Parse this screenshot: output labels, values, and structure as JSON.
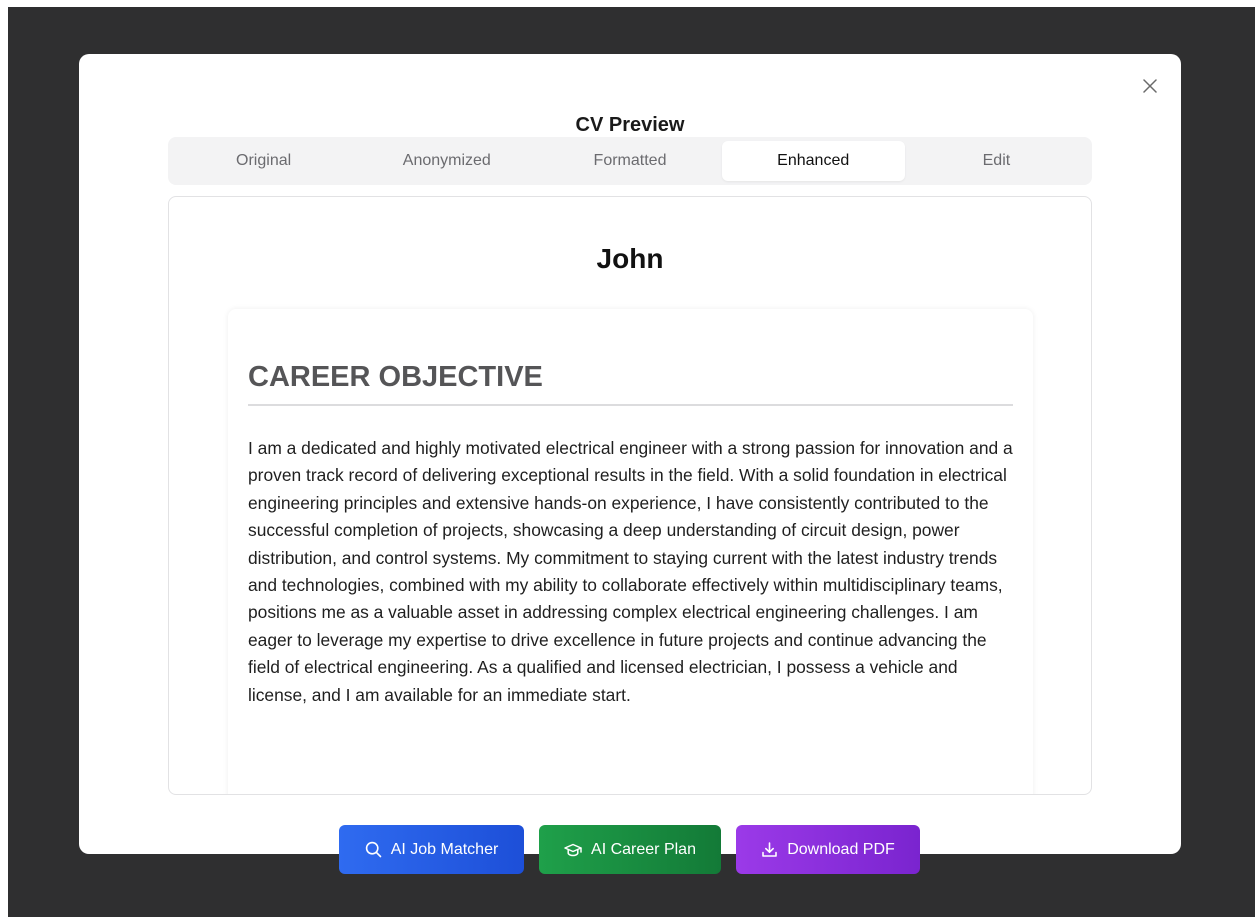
{
  "modal": {
    "title": "CV Preview",
    "close_symbol": "×"
  },
  "tabs": [
    {
      "label": "Original",
      "active": false
    },
    {
      "label": "Anonymized",
      "active": false
    },
    {
      "label": "Formatted",
      "active": false
    },
    {
      "label": "Enhanced",
      "active": true
    },
    {
      "label": "Edit",
      "active": false
    }
  ],
  "cv": {
    "name": "John",
    "section": {
      "heading": "CAREER OBJECTIVE",
      "text": "I am a dedicated and highly motivated electrical engineer with a strong passion for innovation and a proven track record of delivering exceptional results in the field. With a solid foundation in electrical engineering principles and extensive hands-on experience, I have consistently contributed to the successful completion of projects, showcasing a deep understanding of circuit design, power distribution, and control systems. My commitment to staying current with the latest industry trends and technologies, combined with my ability to collaborate effectively within multidisciplinary teams, positions me as a valuable asset in addressing complex electrical engineering challenges. I am eager to leverage my expertise to drive excellence in future projects and continue advancing the field of electrical engineering. As a qualified and licensed electrician, I possess a vehicle and license, and I am available for an immediate start."
    }
  },
  "actions": {
    "job_matcher": {
      "label": "AI Job Matcher",
      "icon": "search-icon",
      "color": "#2f6bf0"
    },
    "career_plan": {
      "label": "AI Career Plan",
      "icon": "graduation-cap-icon",
      "color": "#1fa04a"
    },
    "download_pdf": {
      "label": "Download PDF",
      "icon": "download-icon",
      "color": "#9b3ae8"
    }
  }
}
